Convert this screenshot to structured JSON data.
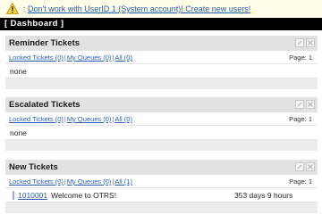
{
  "notice": {
    "separator": ":",
    "link_text": "Don't work with UserID 1 (System account)! Create new users!"
  },
  "dashboard": {
    "title": "[ Dashboard ]"
  },
  "widgets": [
    {
      "title": "Reminder Tickets",
      "filters": {
        "locked": "Locked Tickets (0)",
        "queues": "My Queues (0)",
        "all": "All (0)"
      },
      "page_label": "Page:",
      "page": "1",
      "empty_text": "none"
    },
    {
      "title": "Escalated Tickets",
      "filters": {
        "locked": "Locked Tickets (0)",
        "queues": "My Queues (0)",
        "all": "All (0)"
      },
      "page_label": "Page:",
      "page": "1",
      "empty_text": "none"
    },
    {
      "title": "New Tickets",
      "filters": {
        "locked": "Locked Tickets (0)",
        "queues": "My Queues (0)",
        "all": "All (1)"
      },
      "page_label": "Page:",
      "page": "1",
      "tickets": [
        {
          "number": "1010001",
          "title": "Welcome to OTRS!",
          "age": "353 days 9 hours"
        }
      ]
    }
  ],
  "icons": {
    "warning": "warning-icon",
    "edit": "pencil-icon",
    "close": "close-icon"
  },
  "colors": {
    "notice_bg": "#fffde8",
    "dashboard_bar": "#000000",
    "header_bg": "#e2e2e2",
    "link": "#2a5db0"
  }
}
